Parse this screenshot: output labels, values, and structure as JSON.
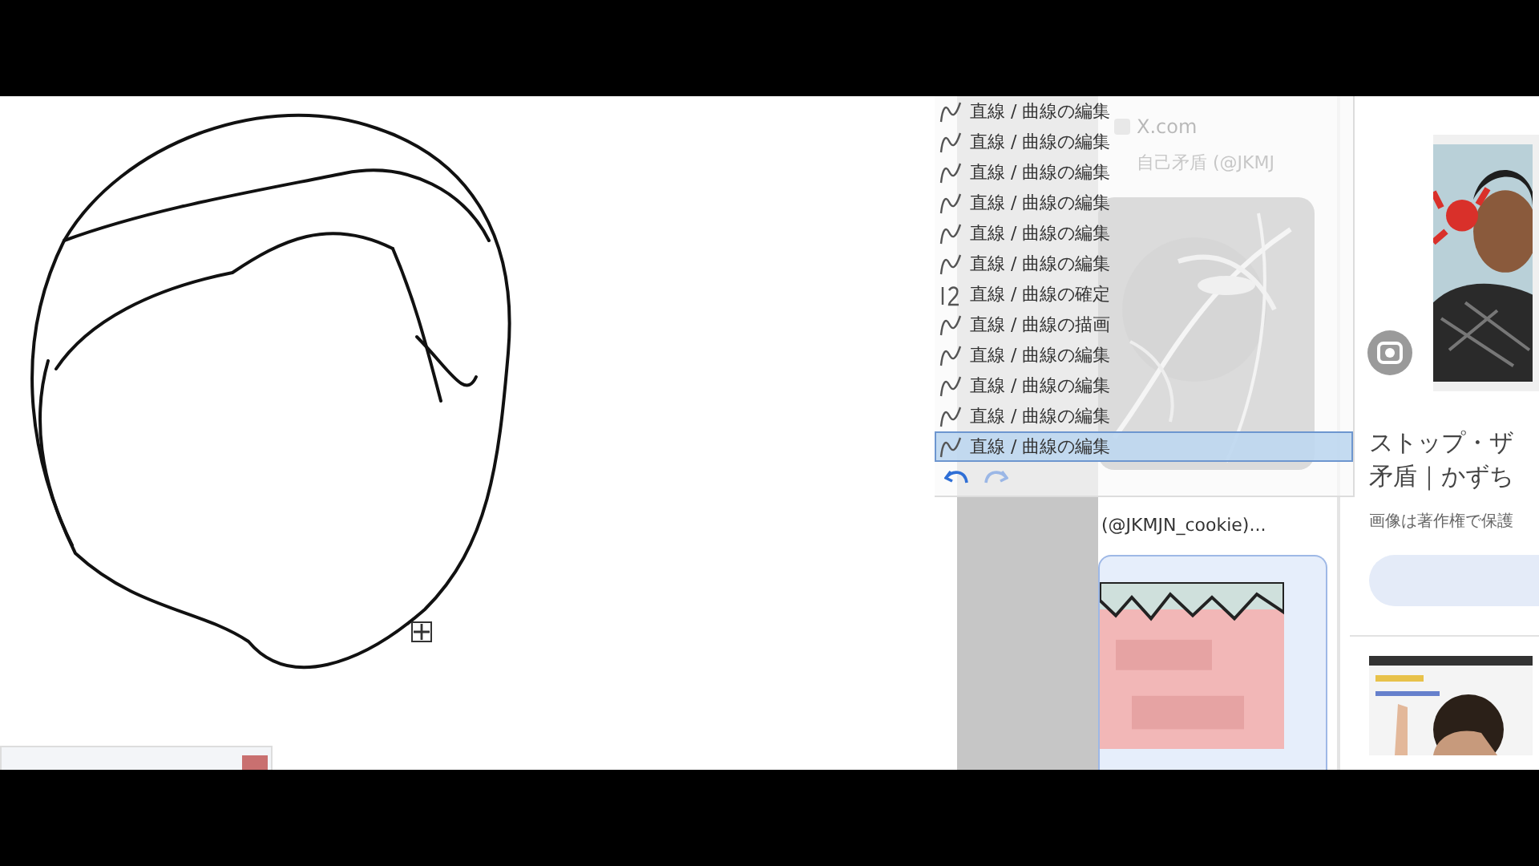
{
  "history_panel": {
    "items": [
      {
        "label": "直線 / 曲線の編集",
        "kind": "edit",
        "selected": false
      },
      {
        "label": "直線 / 曲線の編集",
        "kind": "edit",
        "selected": false
      },
      {
        "label": "直線 / 曲線の編集",
        "kind": "edit",
        "selected": false
      },
      {
        "label": "直線 / 曲線の編集",
        "kind": "edit",
        "selected": false
      },
      {
        "label": "直線 / 曲線の編集",
        "kind": "edit",
        "selected": false
      },
      {
        "label": "直線 / 曲線の編集",
        "kind": "edit",
        "selected": false
      },
      {
        "label": "直線 / 曲線の確定",
        "kind": "confirm",
        "selected": false
      },
      {
        "label": "直線 / 曲線の描画",
        "kind": "edit",
        "selected": false
      },
      {
        "label": "直線 / 曲線の編集",
        "kind": "edit",
        "selected": false
      },
      {
        "label": "直線 / 曲線の編集",
        "kind": "edit",
        "selected": false
      },
      {
        "label": "直線 / 曲線の編集",
        "kind": "edit",
        "selected": false
      },
      {
        "label": "直線 / 曲線の編集",
        "kind": "edit",
        "selected": true
      }
    ]
  },
  "browser": {
    "source": "X.com",
    "result_title": "自己矛盾 (@JKMJ",
    "handle": "(@JKMJN_cookie)...",
    "side_title_lines": [
      "ストップ・ザ",
      "矛盾｜かずち"
    ],
    "side_caption": "画像は著作権で保護"
  }
}
